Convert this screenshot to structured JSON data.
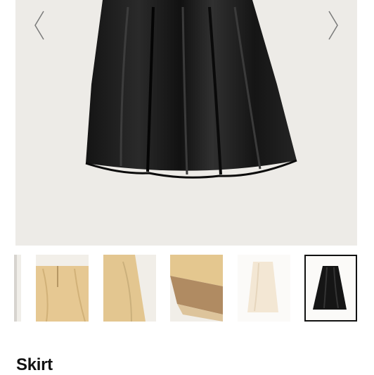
{
  "gallery": {
    "main_image": "black-faux-leather-flared-skirt",
    "prev_icon": "chevron-left-icon",
    "next_icon": "chevron-right-icon",
    "background": "#edebe7"
  },
  "thumbnails": [
    {
      "name": "thumb-partial-edge"
    },
    {
      "name": "thumb-beige-skirt-back-zipper"
    },
    {
      "name": "thumb-beige-skirt-side"
    },
    {
      "name": "thumb-beige-skirt-hem-lining"
    },
    {
      "name": "thumb-cream-skirt-full"
    },
    {
      "name": "thumb-black-skirt-full",
      "selected": true
    }
  ],
  "product": {
    "title": "Skirt"
  }
}
